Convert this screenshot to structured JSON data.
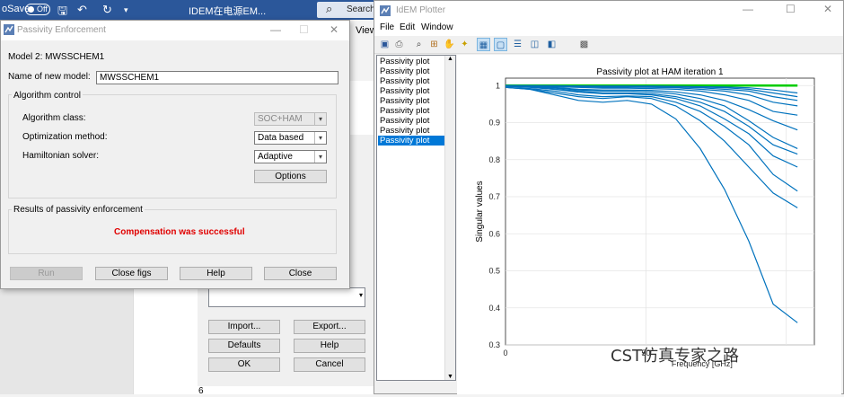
{
  "word": {
    "autosave_label": "oSave",
    "autosave_state": "Off",
    "doc_title": "IDEM在电源EM...",
    "search_label": "Search",
    "view_tab": "View",
    "page_number": "6"
  },
  "back_dialog": {
    "import_label": "Import...",
    "export_label": "Export...",
    "defaults_label": "Defaults",
    "help_label": "Help",
    "ok_label": "OK",
    "cancel_label": "Cancel"
  },
  "passivity": {
    "title": "Passivity Enforcement",
    "model_label": "Model 2: MWSSCHEM1",
    "name_label": "Name of new model:",
    "name_value": "MWSSCHEM1",
    "algo_group": "Algorithm control",
    "algo_class_label": "Algorithm class:",
    "algo_class_value": "SOC+HAM",
    "opt_label": "Optimization method:",
    "opt_value": "Data based",
    "ham_label": "Hamiltonian solver:",
    "ham_value": "Adaptive",
    "options_label": "Options",
    "results_group": "Results of passivity enforcement",
    "result_text": "Compensation was successful",
    "result_color": "#e00000",
    "run_label": "Run",
    "close_figs_label": "Close figs",
    "help_label": "Help",
    "close_label": "Close"
  },
  "plotter": {
    "title": "IdEM Plotter",
    "menu": [
      "File",
      "Edit",
      "Window"
    ],
    "list_items": [
      "Passivity plot",
      "Passivity plot",
      "Passivity plot",
      "Passivity plot",
      "Passivity plot",
      "Passivity plot",
      "Passivity plot",
      "Passivity plot",
      "Passivity plot"
    ],
    "selected_index": 8
  },
  "watermark": "CST仿真专家之路",
  "chart_data": {
    "type": "line",
    "title": "Passivity plot at HAM iteration 1",
    "ylabel": "Singular values",
    "xlabel_partial": "Frequency [GHz]",
    "xlim": [
      0,
      110
    ],
    "ylim": [
      0.3,
      1.02
    ],
    "xticks": [
      0,
      50
    ],
    "yticks": [
      0.3,
      0.4,
      0.5,
      0.6,
      0.7,
      0.8,
      0.9,
      1
    ],
    "series_color": "#0072bd",
    "threshold_color": "#00cc00",
    "threshold": 1,
    "x": [
      0,
      10,
      20,
      30,
      40,
      50,
      60,
      70,
      80,
      90,
      100,
      110
    ],
    "series": [
      {
        "values": [
          0.995,
          0.99,
          0.975,
          0.96,
          0.955,
          0.96,
          0.95,
          0.91,
          0.83,
          0.72,
          0.58,
          0.41,
          0.36
        ]
      },
      {
        "values": [
          0.995,
          0.99,
          0.98,
          0.97,
          0.965,
          0.97,
          0.965,
          0.945,
          0.905,
          0.85,
          0.78,
          0.71,
          0.67
        ]
      },
      {
        "values": [
          0.995,
          0.992,
          0.985,
          0.975,
          0.97,
          0.972,
          0.97,
          0.955,
          0.93,
          0.89,
          0.84,
          0.76,
          0.715
        ]
      },
      {
        "values": [
          0.998,
          0.995,
          0.99,
          0.982,
          0.978,
          0.978,
          0.975,
          0.965,
          0.945,
          0.91,
          0.87,
          0.81,
          0.78
        ]
      },
      {
        "values": [
          0.998,
          0.996,
          0.99,
          0.985,
          0.98,
          0.98,
          0.978,
          0.97,
          0.955,
          0.93,
          0.89,
          0.84,
          0.815
        ]
      },
      {
        "values": [
          0.999,
          0.997,
          0.993,
          0.988,
          0.985,
          0.985,
          0.983,
          0.977,
          0.965,
          0.945,
          0.905,
          0.86,
          0.83
        ]
      },
      {
        "values": [
          0.999,
          0.998,
          0.995,
          0.99,
          0.988,
          0.988,
          0.987,
          0.983,
          0.975,
          0.96,
          0.935,
          0.905,
          0.88
        ]
      },
      {
        "values": [
          1.0,
          0.999,
          0.997,
          0.995,
          0.993,
          0.993,
          0.992,
          0.99,
          0.985,
          0.975,
          0.96,
          0.93,
          0.92
        ]
      },
      {
        "values": [
          1.0,
          0.999,
          0.998,
          0.997,
          0.996,
          0.996,
          0.995,
          0.994,
          0.99,
          0.985,
          0.975,
          0.955,
          0.945
        ]
      },
      {
        "values": [
          1.0,
          0.999,
          0.999,
          0.998,
          0.997,
          0.997,
          0.997,
          0.996,
          0.994,
          0.99,
          0.985,
          0.97,
          0.96
        ]
      },
      {
        "values": [
          1.0,
          1.0,
          0.999,
          0.999,
          0.998,
          0.998,
          0.998,
          0.997,
          0.996,
          0.994,
          0.99,
          0.98,
          0.97
        ]
      },
      {
        "values": [
          1.0,
          1.0,
          1.0,
          0.999,
          0.999,
          0.999,
          0.999,
          0.998,
          0.997,
          0.996,
          0.994,
          0.988,
          0.98
        ]
      }
    ]
  }
}
